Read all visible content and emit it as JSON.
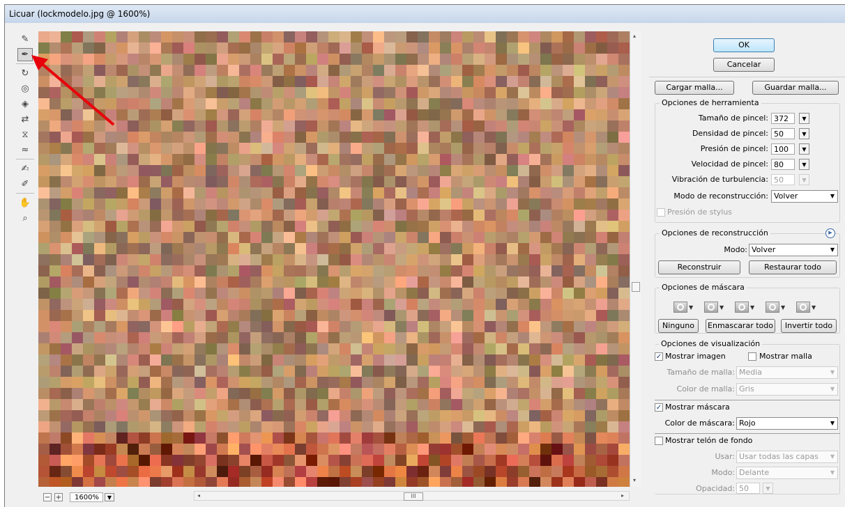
{
  "window": {
    "title": "Licuar (lockmodelo.jpg @ 1600%)"
  },
  "toolbar": {
    "tools": [
      {
        "icon": "warp-icon"
      },
      {
        "icon": "reconstruct-icon"
      },
      {
        "icon": "twirl-icon"
      },
      {
        "icon": "pucker-icon"
      },
      {
        "icon": "bloat-icon"
      },
      {
        "icon": "push-left-icon"
      },
      {
        "icon": "mirror-icon"
      },
      {
        "icon": "turbulence-icon"
      },
      {
        "icon": "freeze-mask-icon"
      },
      {
        "icon": "thaw-mask-icon"
      },
      {
        "icon": "hand-icon"
      },
      {
        "icon": "zoom-icon"
      }
    ],
    "active_index": 1
  },
  "zoom": {
    "value": "1600%",
    "minus": "−",
    "plus": "+"
  },
  "scroll": {
    "thumb_grip": "III"
  },
  "buttons": {
    "ok": "OK",
    "cancel": "Cancelar",
    "load_mesh": "Cargar malla...",
    "save_mesh": "Guardar malla..."
  },
  "tool_options": {
    "legend": "Opciones de herramienta",
    "brush_size_label": "Tamaño de pincel:",
    "brush_size": "372",
    "brush_density_label": "Densidad de pincel:",
    "brush_density": "50",
    "brush_pressure_label": "Presión de pincel:",
    "brush_pressure": "100",
    "brush_rate_label": "Velocidad de pincel:",
    "brush_rate": "80",
    "turbulence_label": "Vibración de turbulencia:",
    "turbulence": "50",
    "reconstruct_mode_label": "Modo de reconstrucción:",
    "reconstruct_mode": "Volver",
    "stylus_label": "Presión de stylus"
  },
  "reconstruct_options": {
    "legend": "Opciones de reconstrucción",
    "mode_label": "Modo:",
    "mode": "Volver",
    "reconstruct_button": "Reconstruir",
    "restore_all_button": "Restaurar todo"
  },
  "mask_options": {
    "legend": "Opciones de máscara",
    "none_button": "Ninguno",
    "mask_all_button": "Enmascarar todo",
    "invert_all_button": "Invertir todo"
  },
  "view_options": {
    "legend": "Opciones de visualización",
    "show_image_label": "Mostrar imagen",
    "show_image": true,
    "show_mesh_label": "Mostrar malla",
    "show_mesh": false,
    "mesh_size_label": "Tamaño de malla:",
    "mesh_size": "Media",
    "mesh_color_label": "Color de malla:",
    "mesh_color": "Gris",
    "show_mask_label": "Mostrar máscara",
    "show_mask": true,
    "mask_color_label": "Color de máscara:",
    "mask_color": "Rojo",
    "show_backdrop_label": "Mostrar telón de fondo",
    "show_backdrop": false,
    "use_label": "Usar:",
    "use": "Usar todas las capas",
    "mode_label": "Modo:",
    "mode": "Delante",
    "opacity_label": "Opacidad:",
    "opacity": "50"
  },
  "colors": {
    "accent_ok": "#bee6fd",
    "annotation_arrow": "#e8000b"
  }
}
